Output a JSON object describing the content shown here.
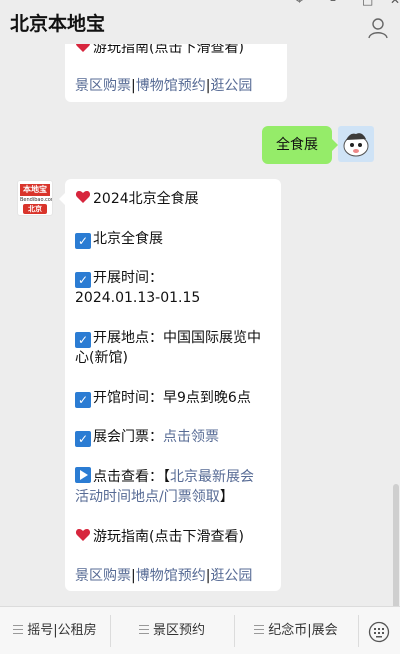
{
  "app": {
    "title": "北京本地宝"
  },
  "top_bubble": {
    "partial_line": "游玩指南(点击下滑查看)",
    "links": [
      "景区购票",
      "博物馆预约",
      "逛公园"
    ],
    "sep": "|"
  },
  "user_message": {
    "text": "全食展"
  },
  "bot_avatar": {
    "brand": "本地宝",
    "site": "Bendibao.com",
    "city": "北京"
  },
  "reply": {
    "heading": "2024北京全食展",
    "name": "北京全食展",
    "time_label": "开展时间：",
    "time_value": "2024.01.13-01.15",
    "place_line1": "开展地点：中国国际展览中",
    "place_line2": "心(新馆)",
    "hours": "开馆时间：早9点到晚6点",
    "ticket_label": "展会门票：",
    "ticket_link": "点击领票",
    "more_label": "点击查看：",
    "more_link_line1_prefix": "【",
    "more_link_line1": "北京最新展会",
    "more_link_line2": "活动时间地点/门票领取",
    "more_link_line2_suffix": "】",
    "guide": "游玩指南(点击下滑查看)",
    "links": [
      "景区购票",
      "博物馆预约",
      "逛公园"
    ],
    "sep": "|"
  },
  "bottom_menu": {
    "items": [
      "摇号|公租房",
      "景区预约",
      "纪念币|展会"
    ]
  },
  "colors": {
    "link": "#576b95",
    "out_bubble": "#95ec69",
    "check": "#2b7cd3",
    "heart": "#d7263d"
  },
  "icons": {
    "heart": "heart-icon",
    "check": "check-box-icon",
    "play": "play-icon",
    "person": "person-icon",
    "keyboard": "keyboard-icon",
    "menu": "menu-icon"
  }
}
